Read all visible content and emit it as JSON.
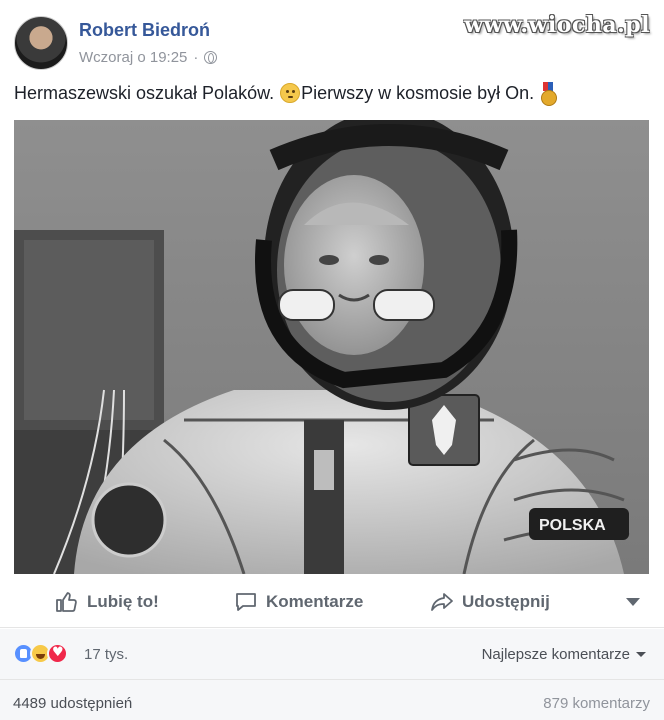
{
  "post": {
    "author": "Robert Biedroń",
    "timestamp": "Wczoraj o 19:25",
    "separator": "·",
    "privacy_icon": "globe-icon",
    "text_part1": "Hermaszewski oszukał Polaków.",
    "text_part2": "Pierwszy w kosmosie był On.",
    "emoji1": "confused-face-emoji",
    "emoji2": "medal-emoji",
    "watermark": "www.wiocha.pl"
  },
  "photo": {
    "patch_text": "POLSKA"
  },
  "actions": {
    "like_label": "Lubię to!",
    "comment_label": "Komentarze",
    "share_label": "Udostępnij"
  },
  "reactions": {
    "types": [
      "like",
      "haha",
      "love"
    ],
    "count": "17 tys.",
    "top_comments_label": "Najlepsze komentarze"
  },
  "stats": {
    "shares": "4489 udostępnień",
    "comments": "879 komentarzy"
  },
  "colors": {
    "link_blue": "#365899",
    "meta_gray": "#90949c",
    "action_gray": "#606770",
    "footer_bg": "#f6f7f9"
  }
}
